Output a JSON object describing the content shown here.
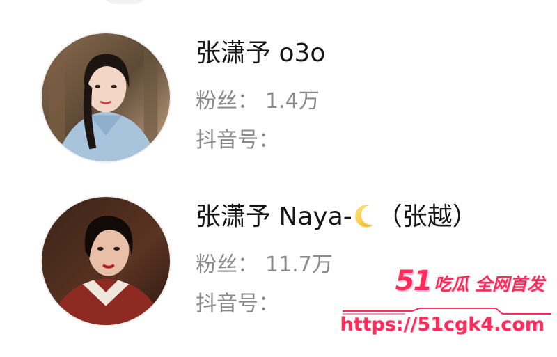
{
  "users": [
    {
      "name": "张潇予 o3o",
      "fans_label": "粉丝：",
      "fans_value": "1.4万",
      "id_label": "抖音号："
    },
    {
      "name_prefix": "张潇予 Naya-",
      "name_icon": "crescent-moon-icon",
      "name_suffix": "（张越）",
      "fans_label": "粉丝：",
      "fans_value": "11.7万",
      "id_label": "抖音号："
    }
  ],
  "watermark": {
    "number": "51",
    "slogan": "吃瓜 全网首发",
    "url": "https://51cgk4.com",
    "color": "#ff2b5a"
  },
  "colors": {
    "name_text": "#161616",
    "secondary_text": "#8a8a8a",
    "background": "#ffffff"
  }
}
